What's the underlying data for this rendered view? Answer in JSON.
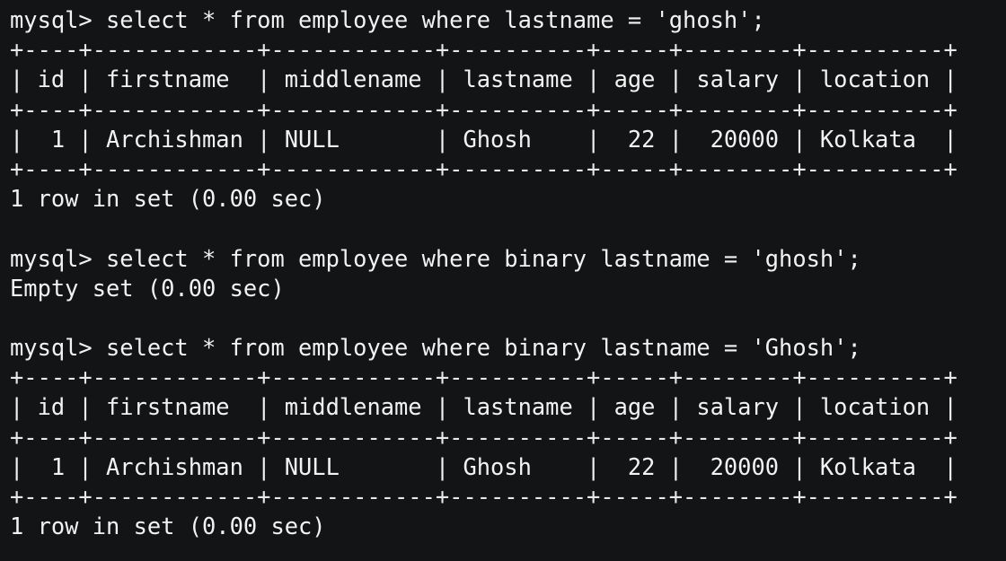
{
  "terminal": {
    "lines": [
      "mysql> select * from employee where lastname = 'ghosh';",
      "+----+------------+------------+----------+-----+--------+----------+",
      "| id | firstname  | middlename | lastname | age | salary | location |",
      "+----+------------+------------+----------+-----+--------+----------+",
      "|  1 | Archishman | NULL       | Ghosh    |  22 |  20000 | Kolkata  |",
      "+----+------------+------------+----------+-----+--------+----------+",
      "1 row in set (0.00 sec)",
      "",
      "mysql> select * from employee where binary lastname = 'ghosh';",
      "Empty set (0.00 sec)",
      "",
      "mysql> select * from employee where binary lastname = 'Ghosh';",
      "+----+------------+------------+----------+-----+--------+----------+",
      "| id | firstname  | middlename | lastname | age | salary | location |",
      "+----+------------+------------+----------+-----+--------+----------+",
      "|  1 | Archishman | NULL       | Ghosh    |  22 |  20000 | Kolkata  |",
      "+----+------------+------------+----------+-----+--------+----------+",
      "1 row in set (0.00 sec)"
    ]
  }
}
